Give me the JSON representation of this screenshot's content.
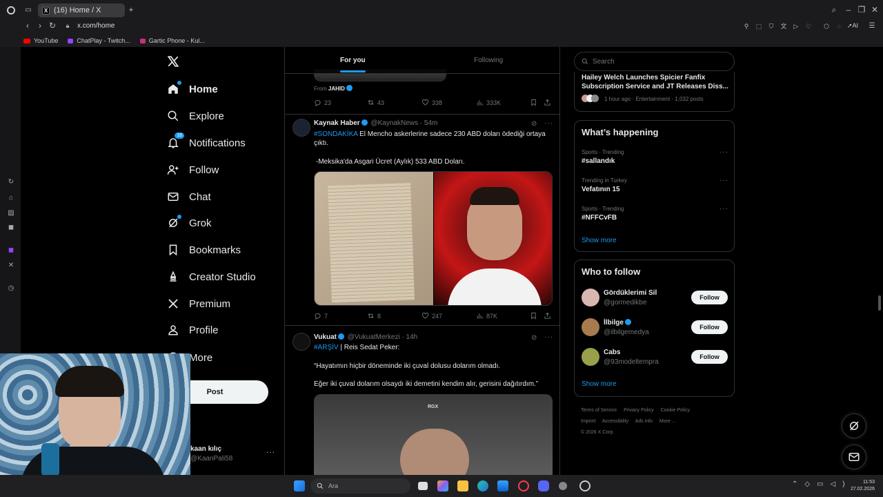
{
  "browser": {
    "tab_title": "(16) Home / X",
    "url": "x.com/home",
    "bookmarks": [
      {
        "label": "YouTube",
        "color": "#ff0000"
      },
      {
        "label": "ChatPlay - Twitch...",
        "color": "#9146ff"
      },
      {
        "label": "Gartic Phone - Kul...",
        "color": "#c9307a"
      }
    ],
    "ai_label": "AI"
  },
  "nav": {
    "items": [
      {
        "label": "Home",
        "icon": "home-icon"
      },
      {
        "label": "Explore",
        "icon": "search-icon"
      },
      {
        "label": "Notifications",
        "icon": "bell-icon",
        "badge": "16"
      },
      {
        "label": "Follow",
        "icon": "add-person-icon"
      },
      {
        "label": "Chat",
        "icon": "envelope-icon"
      },
      {
        "label": "Grok",
        "icon": "grok-icon"
      },
      {
        "label": "Bookmarks",
        "icon": "bookmark-icon"
      },
      {
        "label": "Creator Studio",
        "icon": "creator-icon"
      },
      {
        "label": "Premium",
        "icon": "x-icon"
      },
      {
        "label": "Profile",
        "icon": "person-icon"
      },
      {
        "label": "More",
        "icon": "more-icon"
      }
    ],
    "post_label": "Post",
    "account": {
      "name": "kaan kılıç",
      "handle": "@KaanPali58"
    }
  },
  "timeline": {
    "tabs": [
      "For you",
      "Following"
    ],
    "prev_tweet": {
      "from_label": "From",
      "from_name": "JAHID",
      "replies": "23",
      "reposts": "43",
      "likes": "338",
      "views": "333K"
    },
    "tweets": [
      {
        "name": "Kaynak Haber",
        "handle": "@KaynakNews",
        "time": "· 54m",
        "hashtag": "#SONDAKİKA",
        "text_line1": "El Mencho askerlerine sadece 230 ABD doları ödediği ortaya",
        "text_line2": "çıktı.",
        "text_line3": "-Meksika'da Asgari Ücret (Aylık) 533 ABD Doları.",
        "replies": "7",
        "reposts": "8",
        "likes": "247",
        "views": "87K"
      },
      {
        "name": "Vukuat",
        "handle": "@VukuatMerkezi",
        "time": "· 14h",
        "hashtag": "#ARŞİV",
        "text_line1": "| Reis Sedat Peker:",
        "text_line2": "“Hayatımın hiçbir döneminde iki çuval dolusu dolarım olmadı.",
        "text_line3": "Eğer iki çuval dolarım olsaydı iki demetini kendim alır, gerisini dağıtırdım.”",
        "media_label": "RGX"
      }
    ]
  },
  "sidebar": {
    "search_placeholder": "Search",
    "news": {
      "title": "Hailey Welch Launches Spicier Fanfix Subscription Service and JT Releases Diss...",
      "meta": "1 hour ago · Entertainment · 1,032 posts"
    },
    "happening": {
      "title": "What’s happening",
      "trends": [
        {
          "meta": "Sports · Trending",
          "name": "#sallandık"
        },
        {
          "meta": "Trending in Turkey",
          "name": "Vefatının 15"
        },
        {
          "meta": "Sports · Trending",
          "name": "#NFFCvFB"
        }
      ],
      "show_more": "Show more"
    },
    "who_to_follow": {
      "title": "Who to follow",
      "users": [
        {
          "name": "Gördüklerimi Sil",
          "handle": "@gormedikbe",
          "verified": false
        },
        {
          "name": "İlbilge",
          "handle": "@ilbilgemedya",
          "verified": true
        },
        {
          "name": "Cabs",
          "handle": "@93modeltempra",
          "verified": false
        }
      ],
      "follow_label": "Follow",
      "show_more": "Show more"
    },
    "footer": {
      "links": [
        "Terms of Service",
        "Privacy Policy",
        "Cookie Policy",
        "Imprint",
        "Accessibility",
        "Ads info",
        "More ..."
      ],
      "copyright": "© 2026 X Corp."
    }
  },
  "taskbar": {
    "search_placeholder": "Ara",
    "time": "11:53",
    "date": "27.02.2026"
  },
  "colors": {
    "accent": "#1d9bf0",
    "background": "#000000",
    "border": "#2f3336",
    "muted": "#71767b"
  }
}
